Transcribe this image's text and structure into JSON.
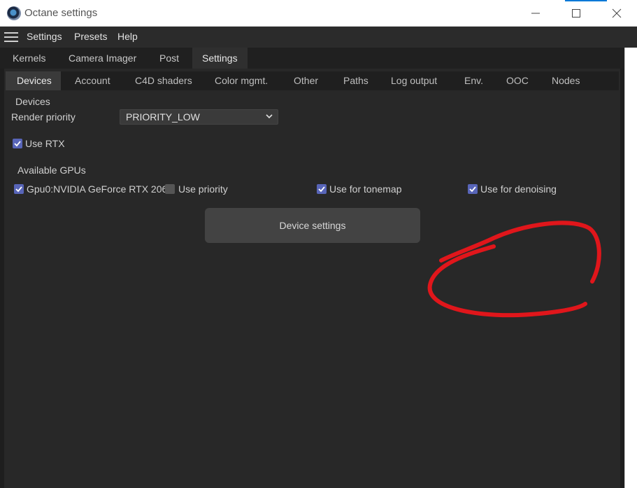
{
  "window": {
    "title": "Octane settings",
    "icons": {
      "app": "octane-logo-icon",
      "minimize": "minimize-icon",
      "maximize": "maximize-icon",
      "close": "close-icon"
    }
  },
  "menubar": {
    "items": [
      "Settings",
      "Presets",
      "Help"
    ],
    "menu_icon": "hamburger-menu-icon"
  },
  "main_tabs": [
    "Kernels",
    "Camera Imager",
    "Post",
    "Settings"
  ],
  "sub_tabs": [
    "Devices",
    "Account",
    "C4D shaders",
    "Color mgmt.",
    "Other",
    "Paths",
    "Log output",
    "Env.",
    "OOC",
    "Nodes"
  ],
  "devices": {
    "section_title": "Devices",
    "render_priority_label": "Render priority",
    "render_priority_value": "PRIORITY_LOW",
    "use_rtx_label": "Use RTX",
    "use_rtx_checked": true,
    "available_gpus_label": "Available GPUs",
    "gpu": {
      "name": "Gpu0:NVIDIA GeForce RTX 206",
      "enabled": true,
      "use_priority_label": "Use priority",
      "use_priority_checked": false,
      "use_for_tonemap_label": "Use for tonemap",
      "use_for_tonemap_checked": true,
      "use_for_denoising_label": "Use for denoising",
      "use_for_denoising_checked": true
    },
    "device_settings_button": "Device settings"
  },
  "colors": {
    "checkbox_checked": "#5865b8",
    "annotation_red": "#e0161b",
    "panel_bg": "#282828"
  }
}
